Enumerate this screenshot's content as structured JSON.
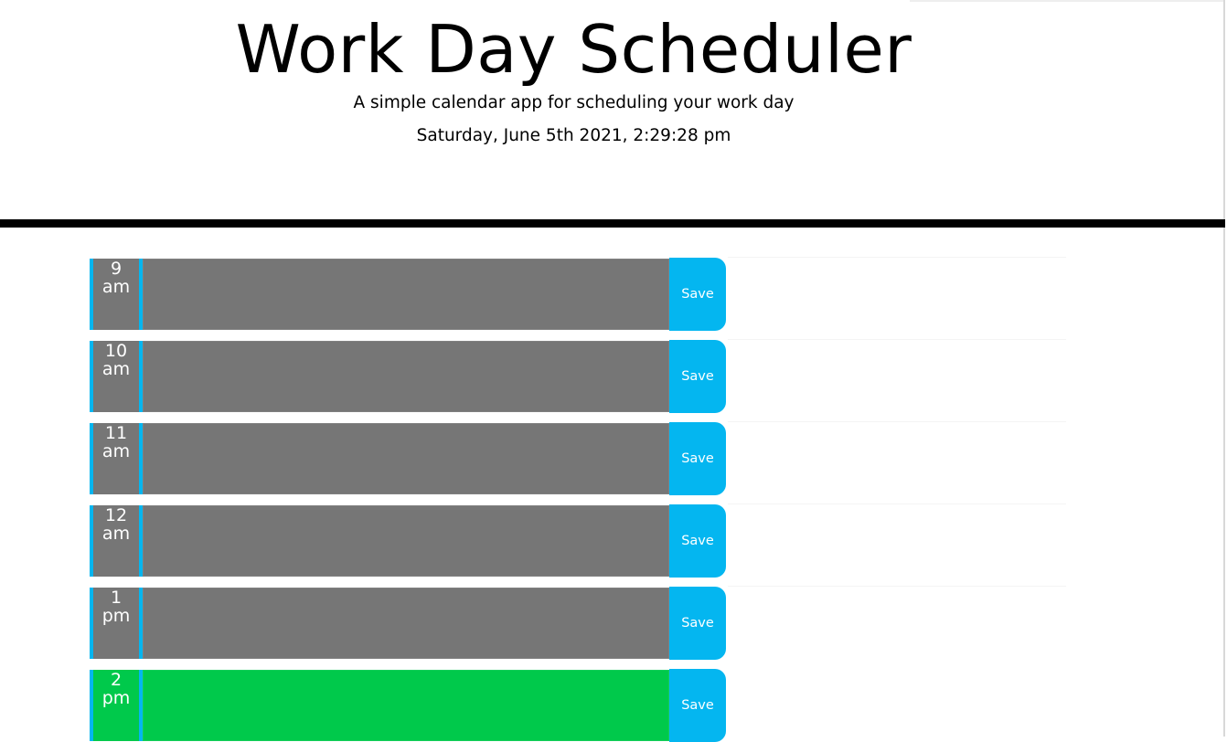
{
  "header": {
    "title": "Work Day Scheduler",
    "lead": "A simple calendar app for scheduling your work day",
    "current_day": "Saturday, June 5th 2021, 2:29:28 pm"
  },
  "colors": {
    "past": "#767676",
    "present": "#00c94b",
    "accent": "#04b6f0"
  },
  "schedule": [
    {
      "hour": "9",
      "period": "am",
      "status": "past",
      "text": "",
      "save_label": "Save"
    },
    {
      "hour": "10",
      "period": "am",
      "status": "past",
      "text": "",
      "save_label": "Save"
    },
    {
      "hour": "11",
      "period": "am",
      "status": "past",
      "text": "",
      "save_label": "Save"
    },
    {
      "hour": "12",
      "period": "am",
      "status": "past",
      "text": "",
      "save_label": "Save"
    },
    {
      "hour": "1",
      "period": "pm",
      "status": "past",
      "text": "",
      "save_label": "Save"
    },
    {
      "hour": "2",
      "period": "pm",
      "status": "present",
      "text": "",
      "save_label": "Save"
    }
  ]
}
